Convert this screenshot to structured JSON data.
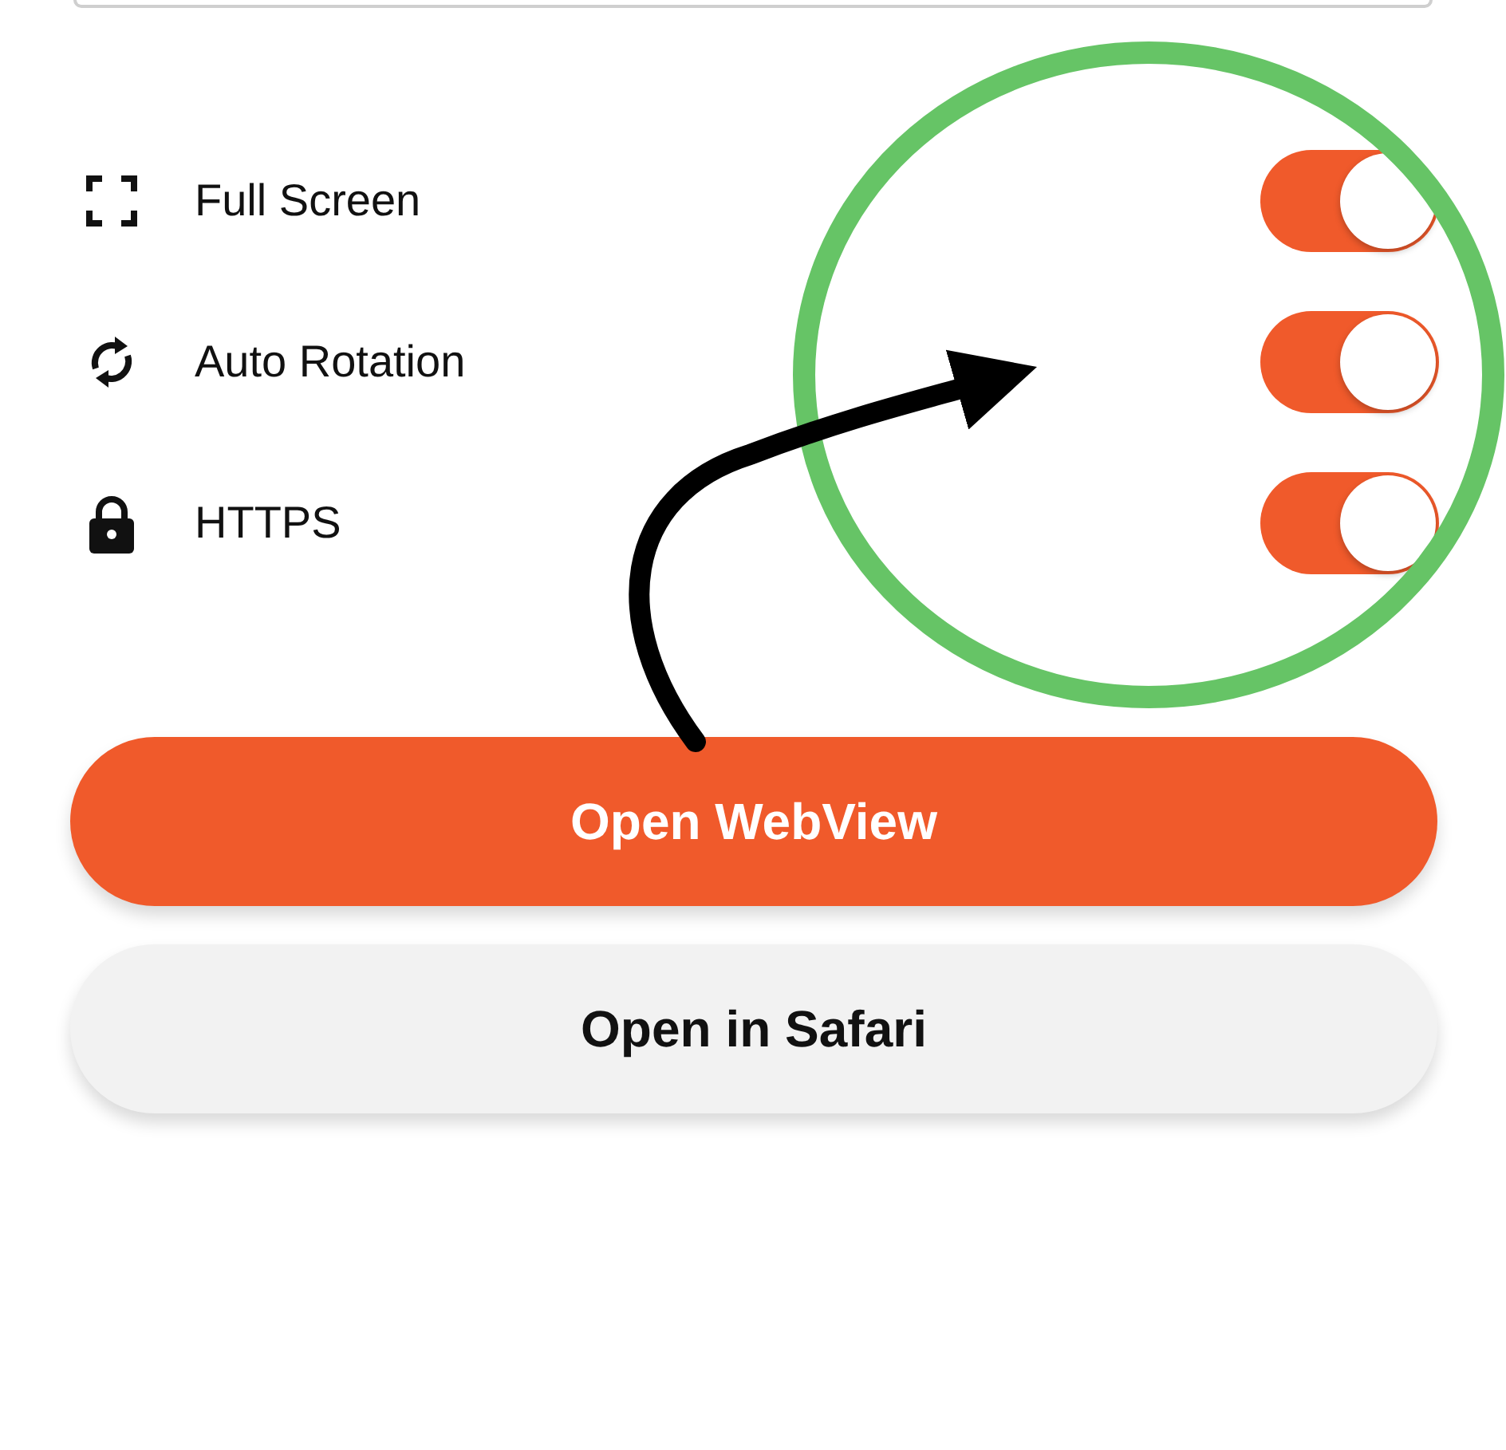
{
  "settings": [
    {
      "kind": "fullscreen",
      "label": "Full Screen",
      "on": true
    },
    {
      "kind": "rotation",
      "label": "Auto Rotation",
      "on": true
    },
    {
      "kind": "lock",
      "label": "HTTPS",
      "on": true
    }
  ],
  "buttons": [
    {
      "kind": "primary",
      "label": "Open WebView"
    },
    {
      "kind": "secondary",
      "label": "Open in Safari"
    }
  ]
}
